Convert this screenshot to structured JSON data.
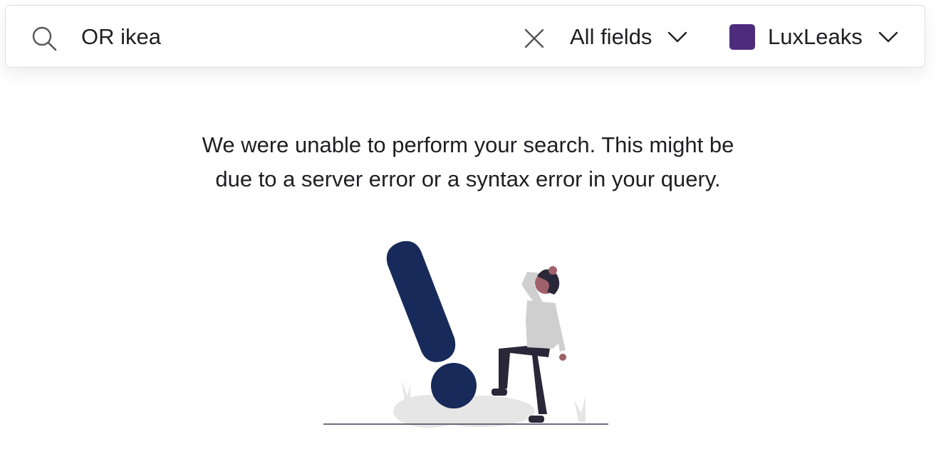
{
  "search": {
    "query": "OR ikea",
    "field_label": "All fields",
    "project_label": "LuxLeaks",
    "project_color": "#4d2c7e"
  },
  "message": {
    "line1": "We were unable to perform your search. This might be",
    "line2": "due to a server error or a syntax error in your query."
  },
  "icons": {
    "search": "search-icon",
    "clear": "close-icon",
    "chevron": "chevron-down-icon"
  },
  "colors": {
    "illustration_primary": "#172a5a",
    "shirt": "#cfcfcf",
    "pants": "#2a2838",
    "skin": "#a0616a"
  }
}
